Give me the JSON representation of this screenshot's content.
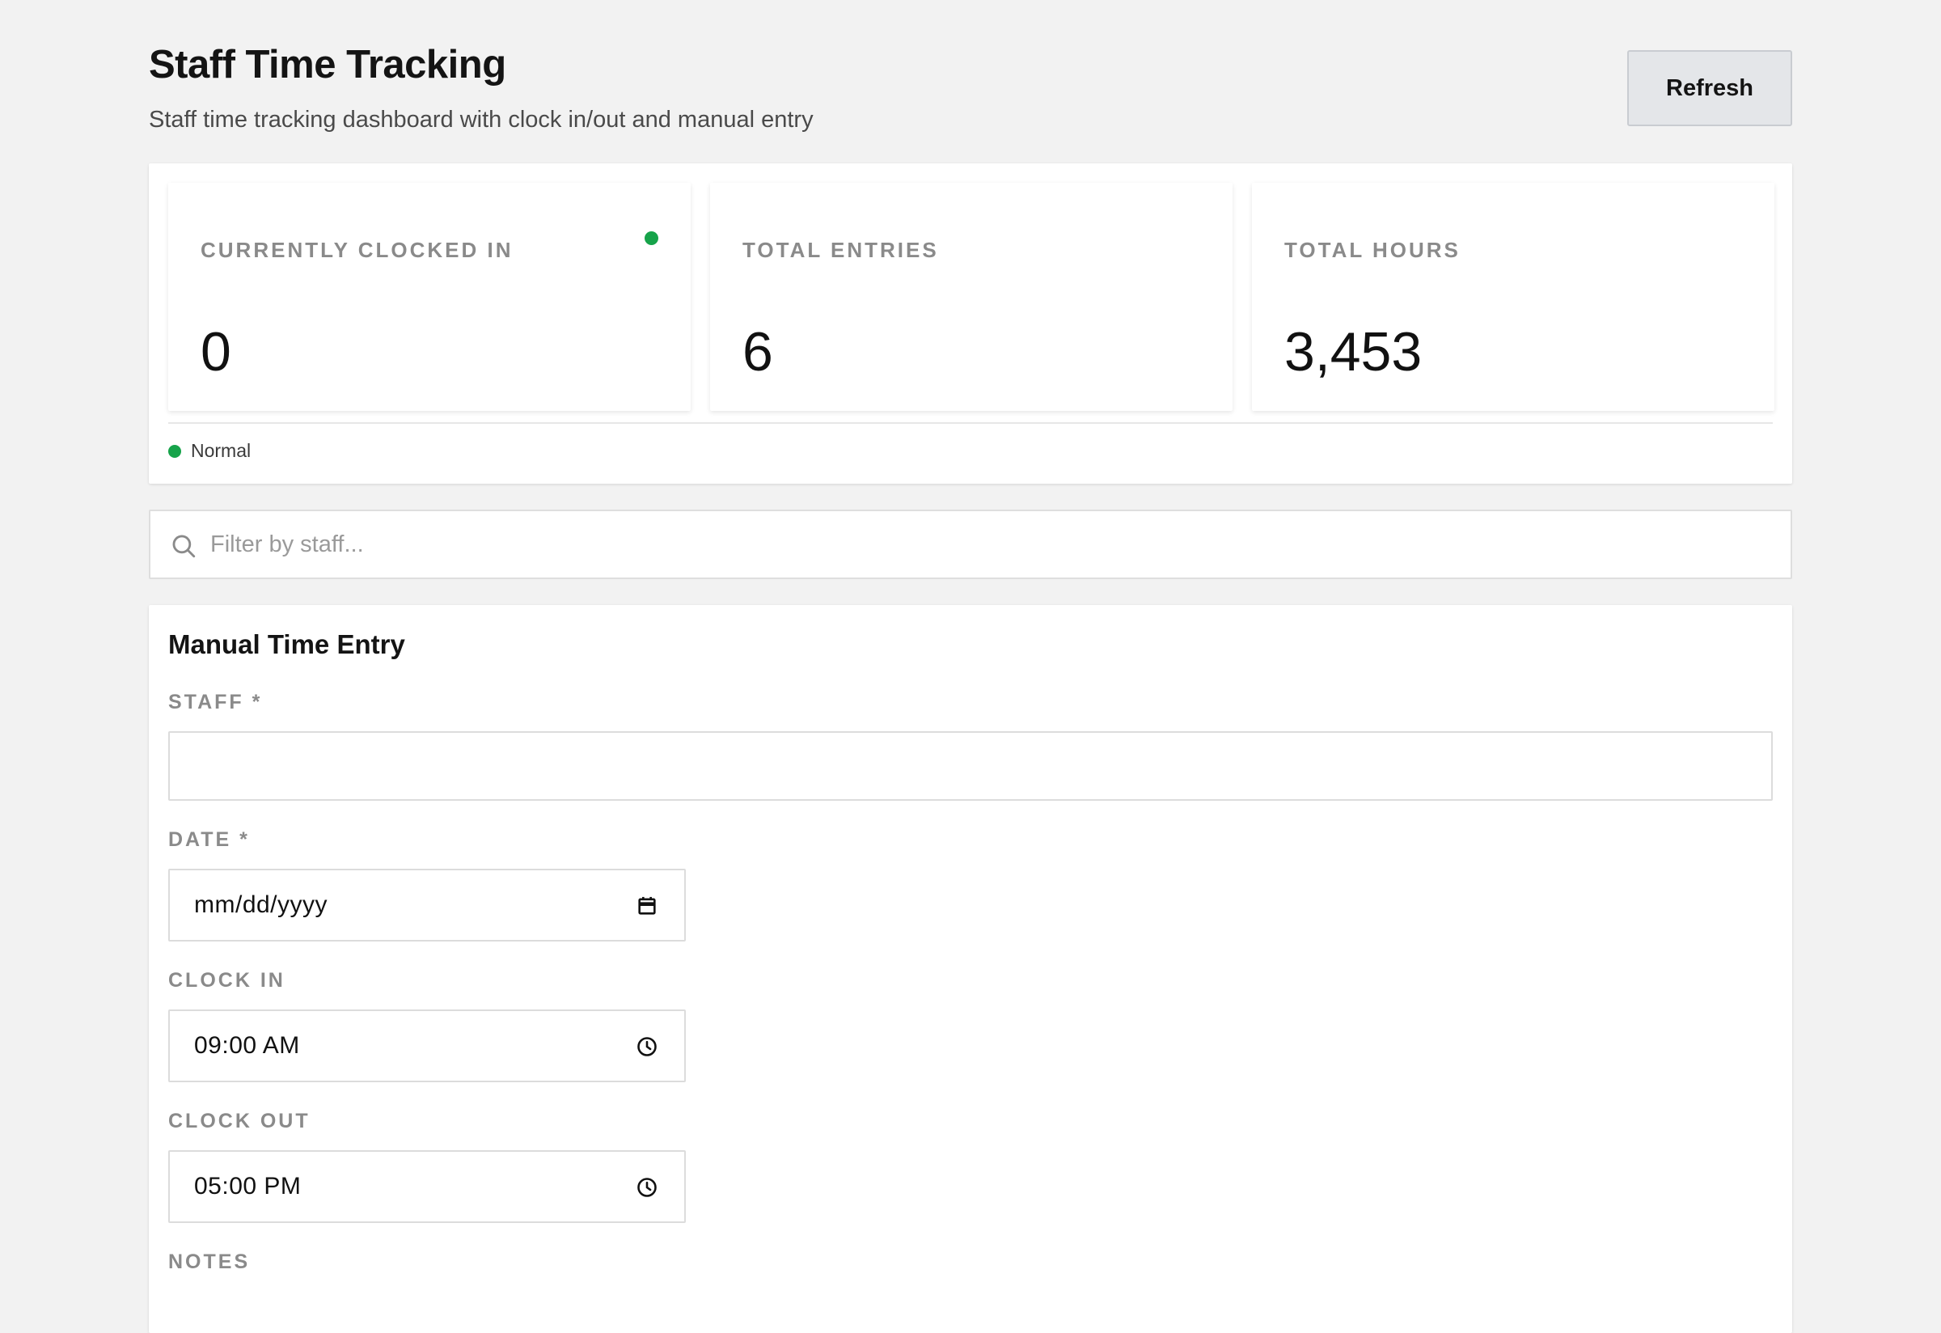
{
  "header": {
    "title": "Staff Time Tracking",
    "subtitle": "Staff time tracking dashboard with clock in/out and manual entry",
    "refresh_label": "Refresh"
  },
  "stats": [
    {
      "label": "CURRENTLY CLOCKED IN",
      "value": "0",
      "live_indicator": true
    },
    {
      "label": "TOTAL ENTRIES",
      "value": "6"
    },
    {
      "label": "TOTAL HOURS",
      "value": "3,453"
    }
  ],
  "status": {
    "text": "Normal",
    "color": "#16a34a"
  },
  "filter": {
    "placeholder": "Filter by staff...",
    "value": ""
  },
  "manual_entry": {
    "title": "Manual Time Entry",
    "staff_label": "STAFF *",
    "staff_value": "",
    "date_label": "DATE *",
    "date_value": "mm/dd/yyyy",
    "clock_in_label": "CLOCK IN",
    "clock_in_value": "09:00 AM",
    "clock_out_label": "CLOCK OUT",
    "clock_out_value": "05:00 PM",
    "notes_label": "NOTES"
  },
  "icons": {
    "search": "search-icon",
    "calendar": "calendar-icon",
    "clock": "clock-icon"
  },
  "colors": {
    "accent_green": "#16a34a",
    "background": "#f2f2f2",
    "button_bg": "#e4e6e9"
  }
}
